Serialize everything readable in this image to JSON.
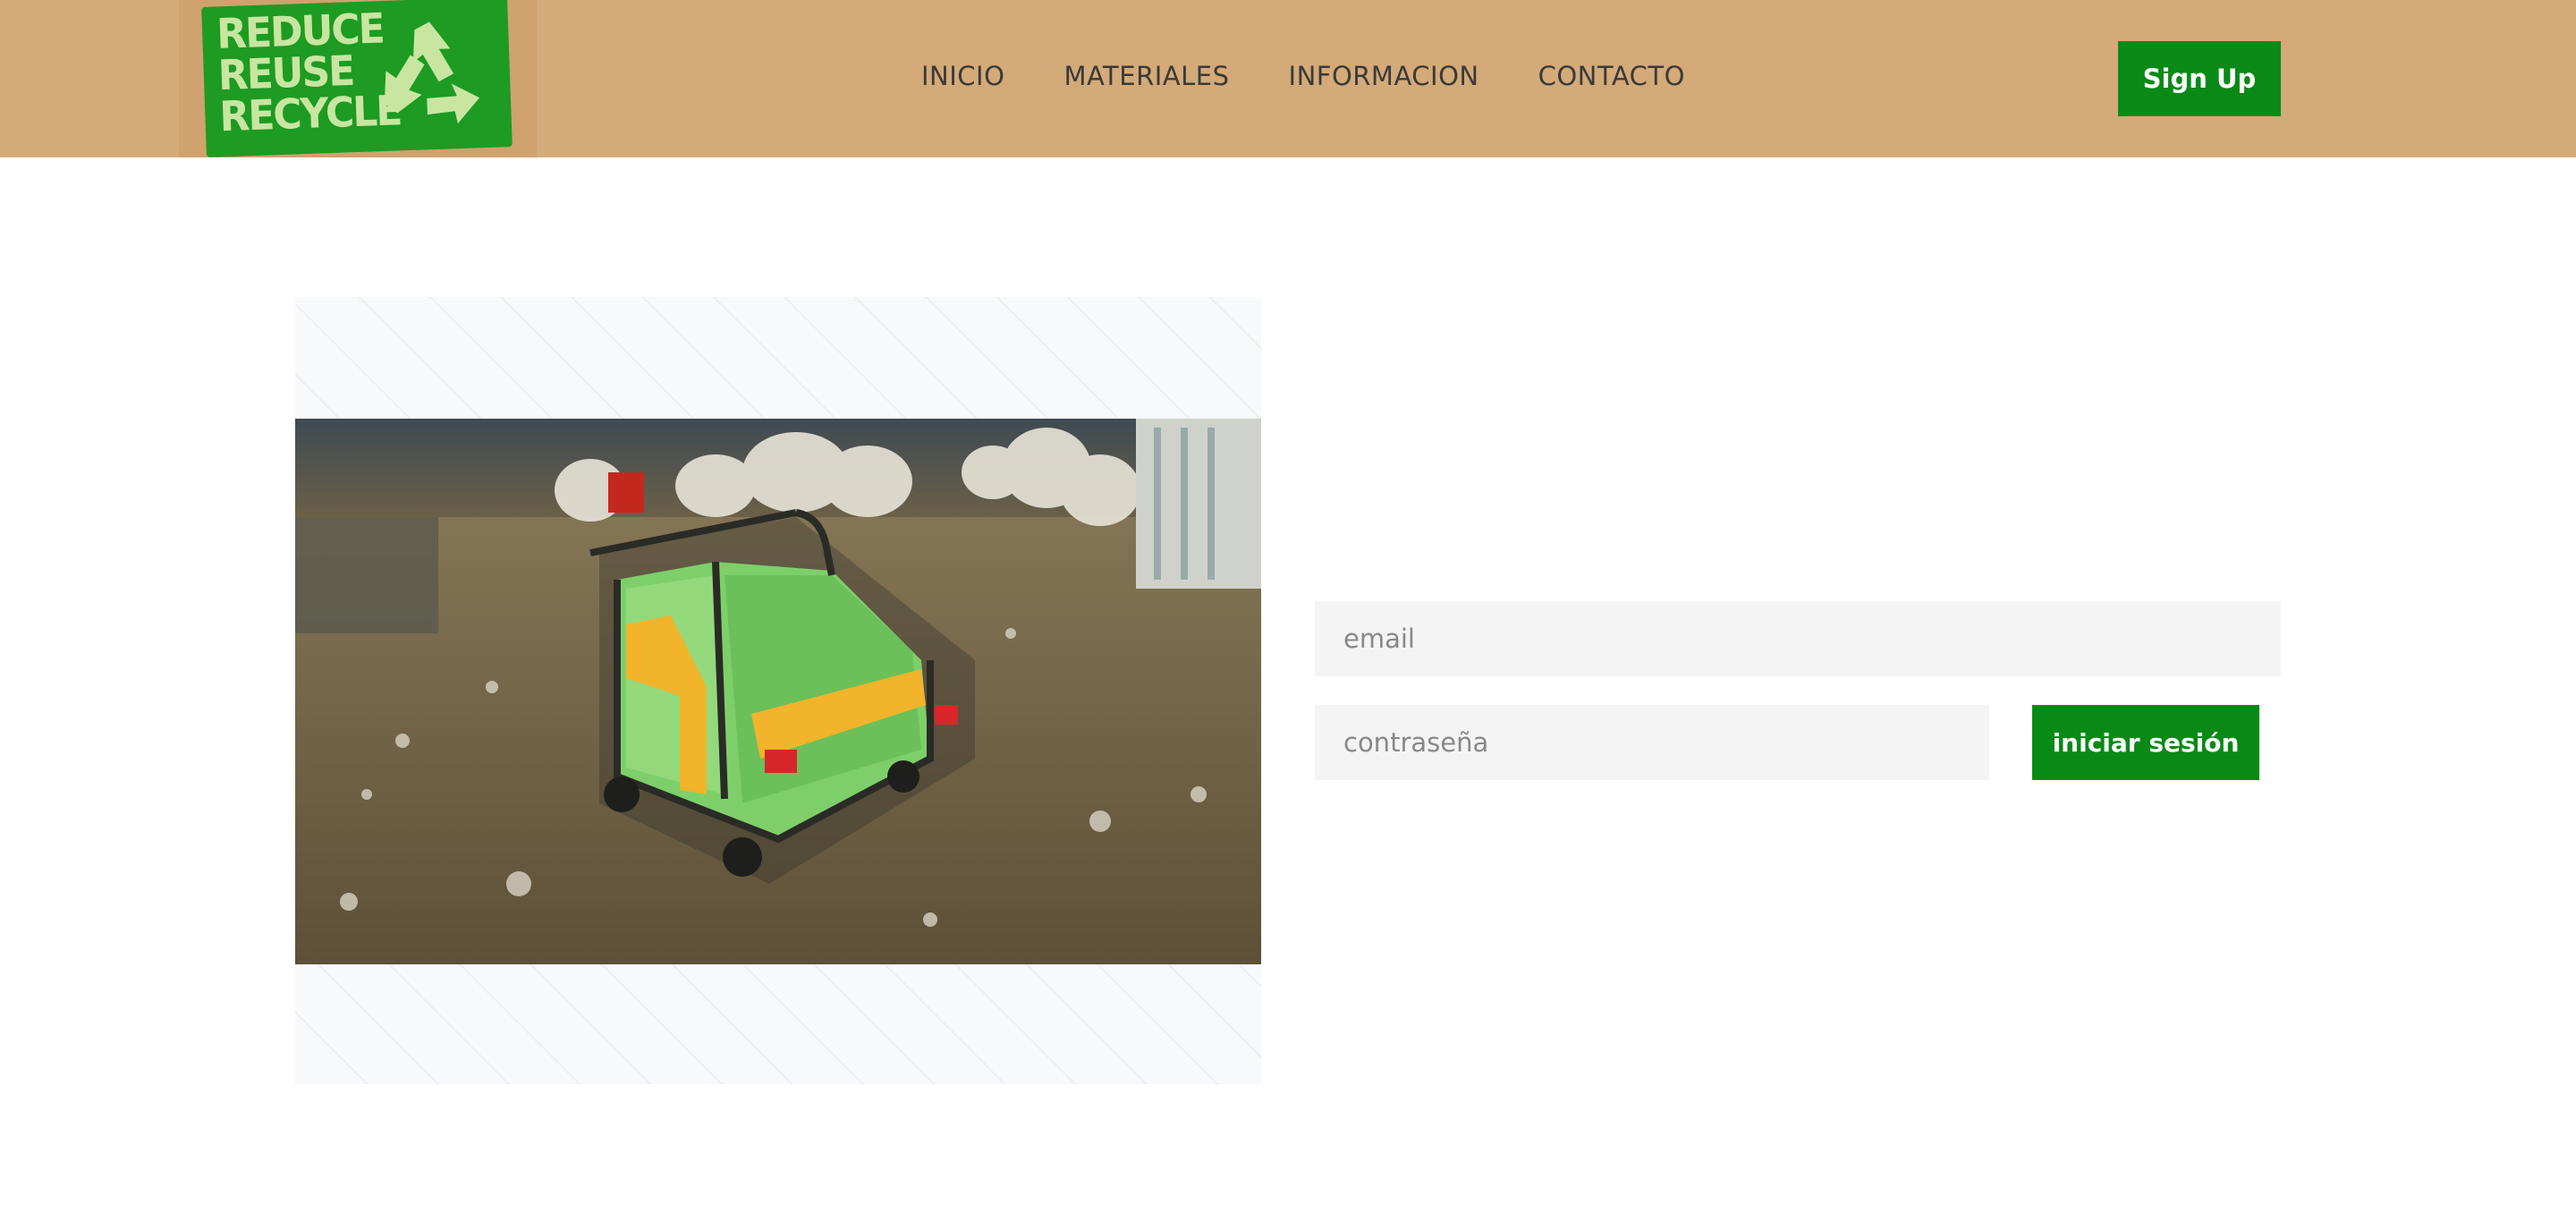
{
  "logo": {
    "lines": [
      "REDUCE",
      "REUSE",
      "RECYCLE"
    ],
    "icon": "recycle-icon",
    "color": "#1d9b23"
  },
  "nav": {
    "items": [
      "INICIO",
      "MATERIALES",
      "INFORMACION",
      "CONTACTO"
    ]
  },
  "header": {
    "signup_label": "Sign Up",
    "background": "#d4aa78"
  },
  "hero": {
    "image": "recycling-warehouse-cart-photo"
  },
  "login": {
    "email_placeholder": "email",
    "password_placeholder": "contraseña",
    "submit_label": "iniciar sesión"
  },
  "colors": {
    "accent": "#098a16",
    "input_bg": "#f4f4f4"
  }
}
